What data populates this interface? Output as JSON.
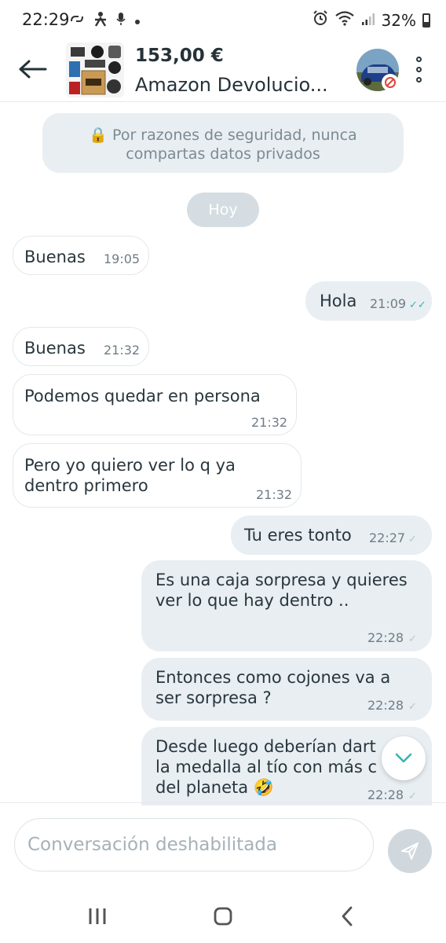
{
  "status_bar": {
    "time": "22:29",
    "battery": "32%",
    "left_icons": [
      "link-icon",
      "accessibility-icon",
      "mic-icon",
      "dot-icon"
    ],
    "right_icons": [
      "alarm-icon",
      "wifi-icon",
      "signal-icon",
      "battery-icon"
    ]
  },
  "header": {
    "price": "153,00 €",
    "title": "Amazon Devolucio..."
  },
  "security_notice": {
    "lock": "🔒",
    "line1": "Por razones de seguridad, nunca",
    "line2": "compartas datos privados"
  },
  "date_separator": "Hoy",
  "messages": [
    {
      "dir": "in",
      "lines": [
        "Buenas"
      ],
      "time": "19:05"
    },
    {
      "dir": "out",
      "lines": [
        "Hola"
      ],
      "time": "21:09",
      "status": "read"
    },
    {
      "dir": "in",
      "lines": [
        "Buenas"
      ],
      "time": "21:32"
    },
    {
      "dir": "in",
      "lines": [
        "Podemos quedar en persona"
      ],
      "time": "21:32"
    },
    {
      "dir": "in",
      "lines": [
        "Pero yo quiero ver lo q ya",
        "dentro primero"
      ],
      "time": "21:32"
    },
    {
      "dir": "out",
      "lines": [
        "Tu eres tonto"
      ],
      "time": "22:27",
      "status": "sent"
    },
    {
      "dir": "out",
      "lines": [
        "Es una caja sorpresa y quieres",
        "ver lo que hay dentro .."
      ],
      "time": "22:28",
      "status": "sent"
    },
    {
      "dir": "out",
      "lines": [
        "Entonces como cojones va a",
        "ser sorpresa ?"
      ],
      "time": "22:28",
      "status": "sent"
    },
    {
      "dir": "out",
      "lines": [
        "Desde luego deberían dart",
        "la medalla al tío con más c",
        "del planeta 🤣"
      ],
      "time": "22:28",
      "status": "sent"
    }
  ],
  "input": {
    "placeholder": "Conversación deshabilitada"
  },
  "colors": {
    "bubble_out": "#e8eef2",
    "bubble_in_border": "#e3e8eb",
    "read_tick": "#34b7b0",
    "text": "#29363d"
  }
}
